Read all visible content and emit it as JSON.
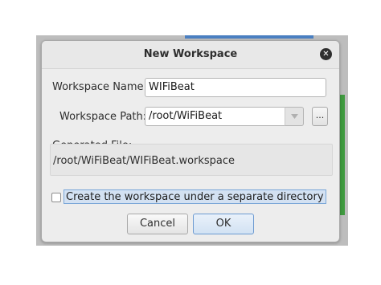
{
  "dialog": {
    "title": "New Workspace",
    "close_icon": "close-icon"
  },
  "form": {
    "workspace_name_label": "Workspace Name:",
    "workspace_name_value": "WIFiBeat",
    "workspace_path_label": "Workspace Path:",
    "workspace_path_value": "/root/WiFiBeat",
    "browse_label": "..."
  },
  "generated": {
    "label": "Generated File:",
    "value": "/root/WiFiBeat/WIFiBeat.workspace"
  },
  "options": {
    "separate_directory_label": "Create the workspace under a separate directory",
    "separate_directory_checked": false
  },
  "buttons": {
    "cancel": "Cancel",
    "ok": "OK"
  },
  "colors": {
    "dialog_bg": "#ededed",
    "accent": "#6c9ad1",
    "background_window": "#bdbdbd"
  }
}
